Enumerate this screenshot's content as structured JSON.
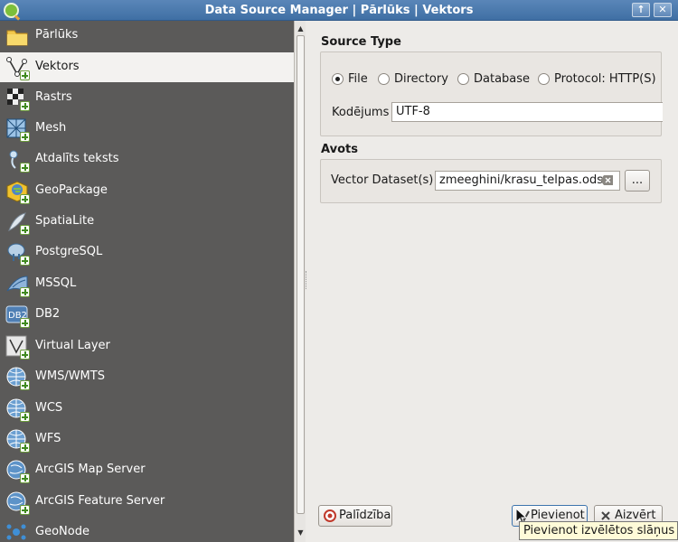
{
  "window": {
    "title": "Data Source Manager | Pārlūks | Vektors",
    "up_button": "↑",
    "close_button": "✕"
  },
  "sidebar": {
    "items": [
      {
        "label": "Pārlūks",
        "icon": "folder-icon"
      },
      {
        "label": "Vektors",
        "icon": "vector-layer-icon"
      },
      {
        "label": "Rastrs",
        "icon": "raster-layer-icon"
      },
      {
        "label": "Mesh",
        "icon": "mesh-layer-icon"
      },
      {
        "label": "Atdalīts teksts",
        "icon": "delimited-text-icon"
      },
      {
        "label": "GeoPackage",
        "icon": "geopackage-icon"
      },
      {
        "label": "SpatiaLite",
        "icon": "spatialite-icon"
      },
      {
        "label": "PostgreSQL",
        "icon": "postgresql-icon"
      },
      {
        "label": "MSSQL",
        "icon": "mssql-icon"
      },
      {
        "label": "DB2",
        "icon": "db2-icon"
      },
      {
        "label": "Virtual Layer",
        "icon": "virtual-layer-icon"
      },
      {
        "label": "WMS/WMTS",
        "icon": "wms-icon"
      },
      {
        "label": "WCS",
        "icon": "wcs-icon"
      },
      {
        "label": "WFS",
        "icon": "wfs-icon"
      },
      {
        "label": "ArcGIS Map Server",
        "icon": "arcgis-map-server-icon"
      },
      {
        "label": "ArcGIS Feature Server",
        "icon": "arcgis-feature-server-icon"
      },
      {
        "label": "GeoNode",
        "icon": "geonode-icon"
      }
    ],
    "active_index": 1
  },
  "source_type": {
    "title": "Source Type",
    "options": [
      "File",
      "Directory",
      "Database",
      "Protocol: HTTP(S)"
    ],
    "selected": "File",
    "encoding_label": "Kodējums",
    "encoding_value": "UTF-8"
  },
  "avots": {
    "title": "Avots",
    "dataset_label": "Vector Dataset(s)",
    "dataset_value": "zmeeghini/krasu_telpas.ods",
    "browse_label": "..."
  },
  "footer": {
    "help_label": "Palīdzība",
    "add_label": "Pievienot",
    "close_label": "Aizvērt",
    "tooltip": "Pievienot izvēlētos slāņus k"
  },
  "colors": {
    "sidebar_bg": "#5b5a59",
    "active_item_bg": "#f3f2f0",
    "titlebar": "#3f6fa4"
  }
}
